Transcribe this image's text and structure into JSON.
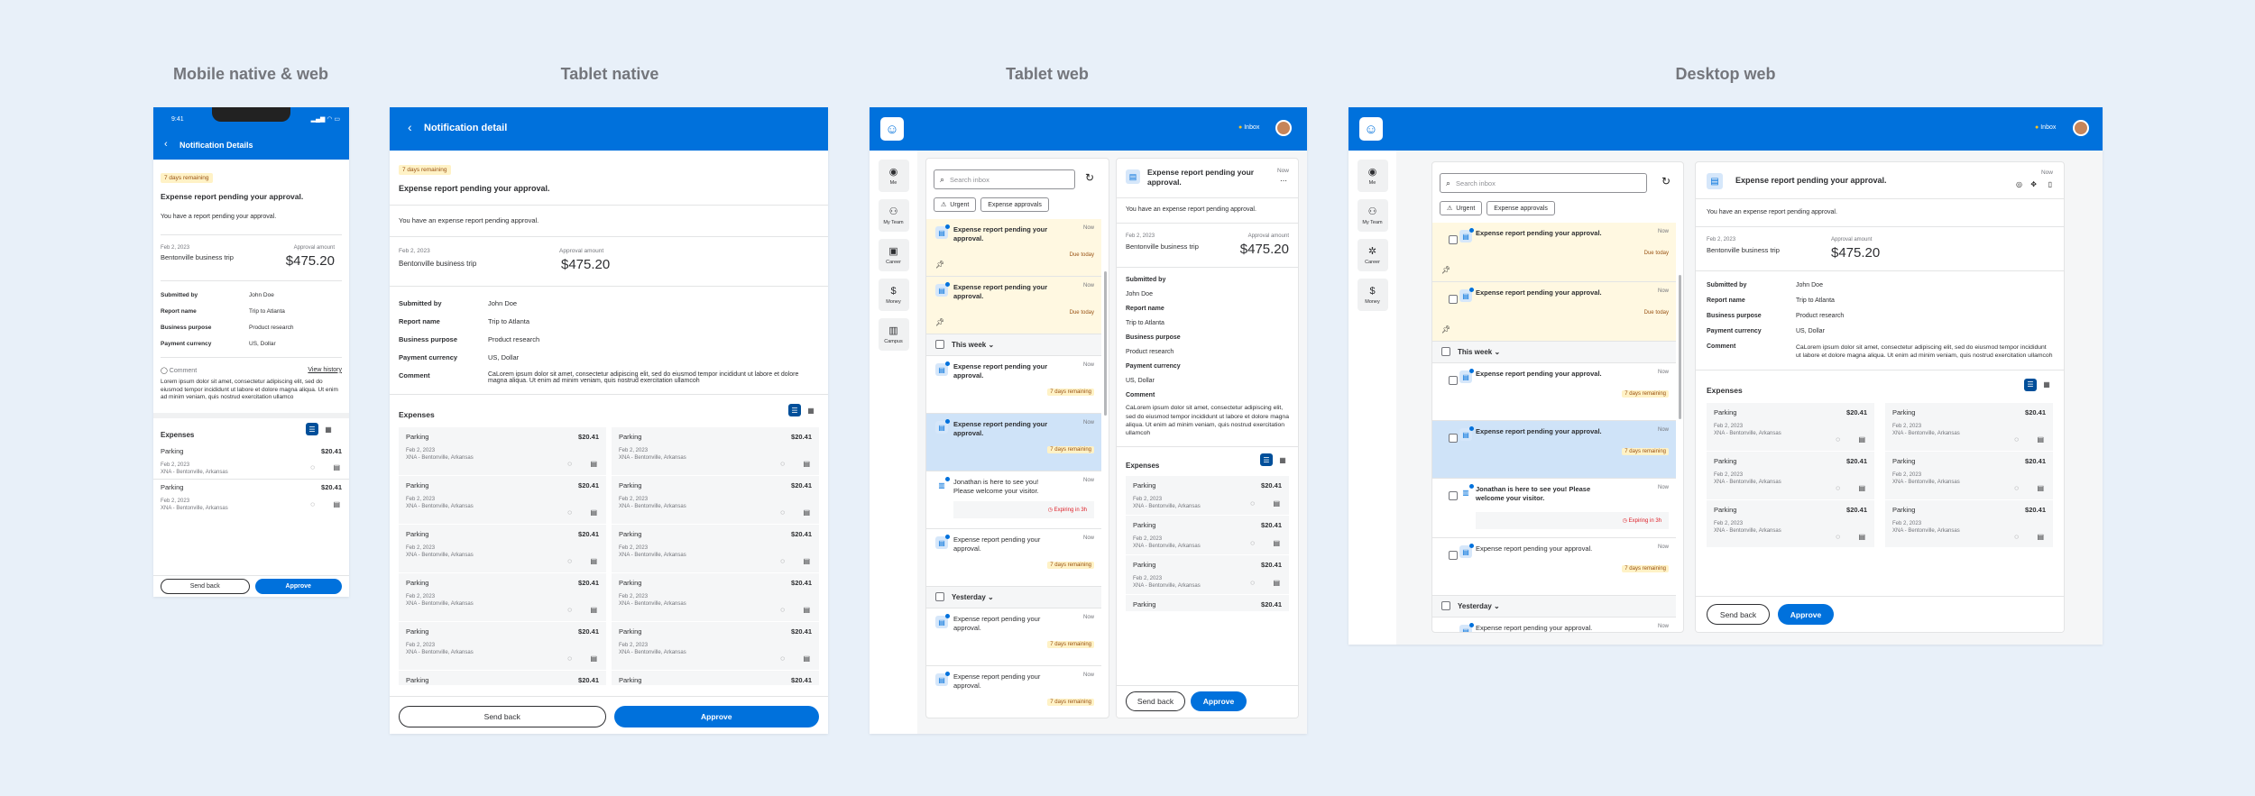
{
  "sections": [
    "Mobile native & web",
    "Tablet native",
    "Tablet web",
    "Desktop web"
  ],
  "common": {
    "badge": "7 days remaining",
    "title": "Expense report pending your approval.",
    "date": "Feb 2, 2023",
    "trip": "Bentonville business trip",
    "approval_label": "Approval amount",
    "amount": "$475.20",
    "submitted_by_k": "Submitted by",
    "submitted_by_v": "John Doe",
    "report_name_k": "Report name",
    "report_name_v": "Trip to Atlanta",
    "purpose_k": "Business purpose",
    "purpose_v": "Product research",
    "currency_k": "Payment currency",
    "currency_v": "US, Dollar",
    "comment_k": "Comment",
    "comment_lorem": "Lorem ipsum dolor sit amet, consectetur adipiscing elit, sed do eiusmod tempor incididunt ut labore et dolore magna aliqua. Ut enim ad minim veniam, quis nostrud exercitation ullamco",
    "comment_calorem": "CaLorem ipsum dolor sit amet, consectetur adipiscing elit, sed do eiusmod tempor incididunt ut labore et dolore magna aliqua. Ut enim ad minim veniam, quis nostrud exercitation ullamcoh",
    "expenses": "Expenses",
    "exp_name": "Parking",
    "exp_amt": "$20.41",
    "exp_date": "Feb 2, 2023",
    "exp_loc": "XNA - Bentonville, Arkansas",
    "send_back": "Send back",
    "approve": "Approve",
    "search_ph": "Search inbox",
    "urgent": "Urgent",
    "expense_approvals": "Expense approvals",
    "now": "Now",
    "due_today": "Due today",
    "this_week": "This week",
    "yesterday": "Yesterday",
    "jonathan": "Jonathan is here to see you! Please welcome your visitor.",
    "expiring": "Expiring in 3h",
    "inbox_label": "Inbox",
    "rail": [
      "Me",
      "My Team",
      "Career",
      "Money",
      "Campus"
    ]
  },
  "mobile": {
    "time": "9:41",
    "header": "Notification Details",
    "subtitle": "You have a report pending your approval.",
    "comment_label": "Comment",
    "view_history": "View history"
  },
  "tablet_native": {
    "header": "Notification detail",
    "subtitle": "You have an expense report pending approval."
  },
  "tablet_web": {
    "subtitle": "You have an expense report pending approval."
  },
  "desktop_web": {
    "subtitle": "You have an expense report pending approval."
  }
}
